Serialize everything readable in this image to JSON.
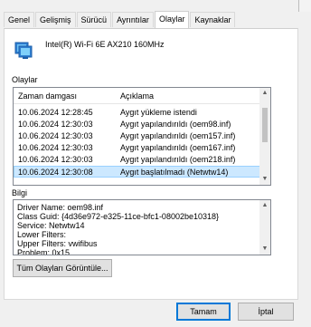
{
  "tabs": [
    "Genel",
    "Gelişmiş",
    "Sürücü",
    "Ayrıntılar",
    "Olaylar",
    "Kaynaklar"
  ],
  "active_tab": "Olaylar",
  "device": {
    "name": "Intel(R) Wi-Fi 6E AX210 160MHz",
    "icon": "network-adapter-icon"
  },
  "events": {
    "section_label": "Olaylar",
    "columns": [
      "Zaman damgası",
      "Açıklama"
    ],
    "rows": [
      [
        "10.06.2024 12:28:45",
        "Aygıt yükleme istendi"
      ],
      [
        "10.06.2024 12:30:03",
        "Aygıt yapılandırıldı (oem98.inf)"
      ],
      [
        "10.06.2024 12:30:03",
        "Aygıt yapılandırıldı (oem157.inf)"
      ],
      [
        "10.06.2024 12:30:03",
        "Aygıt yapılandırıldı (oem167.inf)"
      ],
      [
        "10.06.2024 12:30:03",
        "Aygıt yapılandırıldı (oem218.inf)"
      ],
      [
        "10.06.2024 12:30:08",
        "Aygıt başlatılmadı (Netwtw14)"
      ]
    ],
    "selected_index": 5
  },
  "info": {
    "section_label": "Bilgi",
    "lines": [
      "Driver Name: oem98.inf",
      "Class Guid: {4d36e972-e325-11ce-bfc1-08002be10318}",
      "Service: Netwtw14",
      "Lower Filters:",
      "Upper Filters: vwifibus",
      "Problem: 0x15"
    ]
  },
  "buttons": {
    "view_all": "Tüm Olayları Görüntüle...",
    "ok": "Tamam",
    "cancel": "İptal"
  },
  "colors": {
    "selection_bg": "#cce8ff",
    "selection_border": "#99d1ff",
    "accent": "#0078d7"
  }
}
